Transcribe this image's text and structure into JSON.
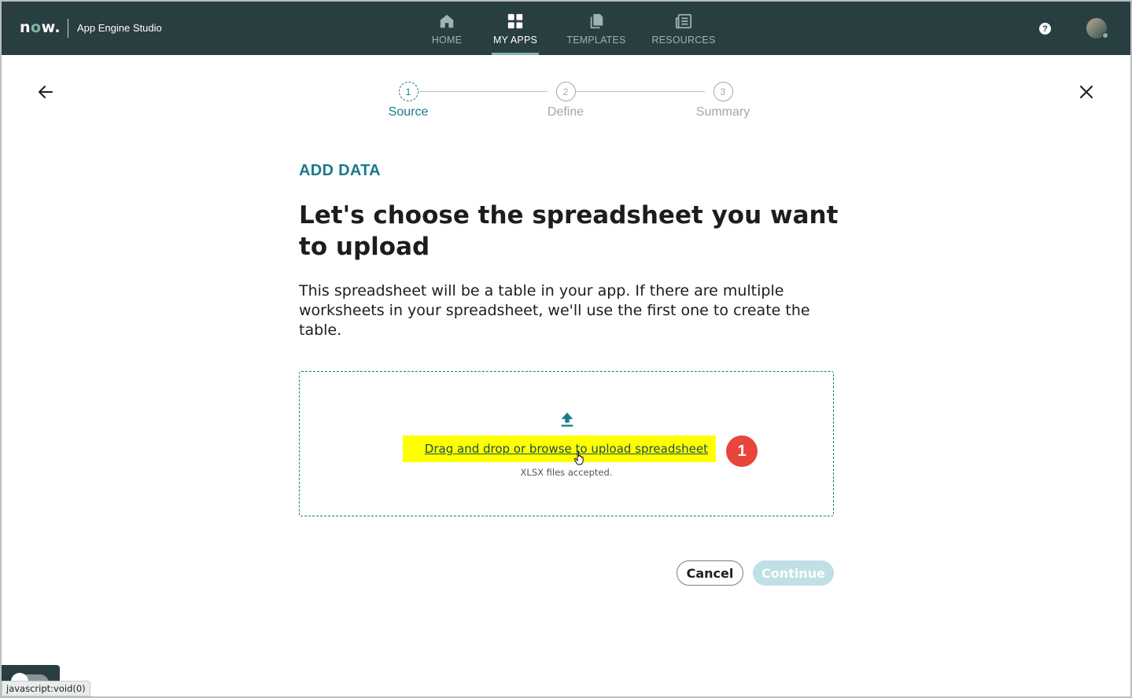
{
  "header": {
    "logo": "now",
    "app_title": "App Engine Studio",
    "nav": [
      {
        "label": "HOME",
        "icon": "home-icon",
        "active": false
      },
      {
        "label": "MY APPS",
        "icon": "grid-icon",
        "active": true
      },
      {
        "label": "TEMPLATES",
        "icon": "copy-icon",
        "active": false
      },
      {
        "label": "RESOURCES",
        "icon": "newspaper-icon",
        "active": false
      }
    ],
    "help_label": "?"
  },
  "stepper": [
    {
      "number": "1",
      "label": "Source",
      "active": true
    },
    {
      "number": "2",
      "label": "Define",
      "active": false
    },
    {
      "number": "3",
      "label": "Summary",
      "active": false
    }
  ],
  "main": {
    "eyebrow": "ADD DATA",
    "headline": "Let's choose the spreadsheet you want to upload",
    "description": "This spreadsheet will be a table in your app. If there are multiple worksheets in your spreadsheet, we'll use the first one to create the table.",
    "upload_link": "Drag and drop or browse to upload spreadsheet",
    "accepted_note": "XLSX files accepted.",
    "step_badge": "1"
  },
  "footer": {
    "cancel_label": "Cancel",
    "continue_label": "Continue"
  },
  "status_bar_url": "javascript:void(0)",
  "colors": {
    "topbar": "#293e40",
    "accent": "#1b7a8a",
    "nav_underline": "#81b5a1",
    "highlight": "#ffff00",
    "badge": "#e8453c",
    "continue_disabled": "#bfe0e4"
  }
}
